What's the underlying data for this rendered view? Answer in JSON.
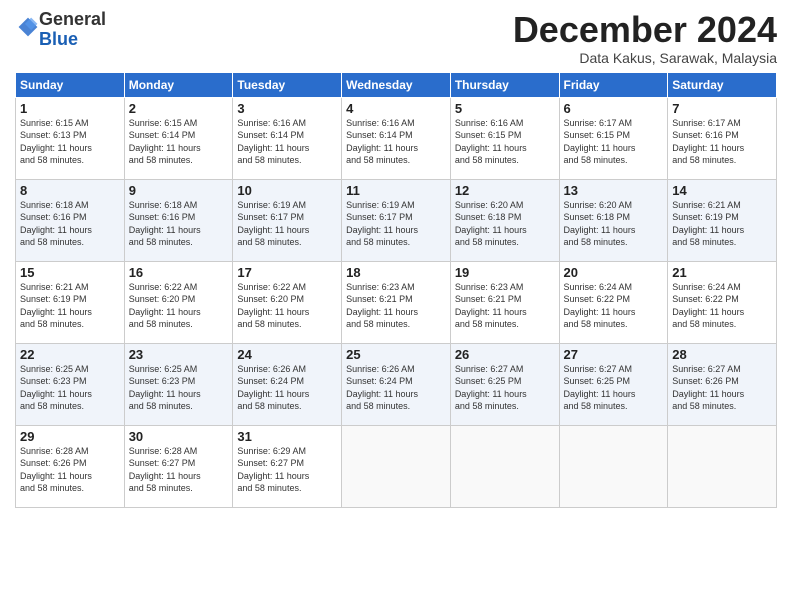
{
  "header": {
    "logo_general": "General",
    "logo_blue": "Blue",
    "month_title": "December 2024",
    "subtitle": "Data Kakus, Sarawak, Malaysia"
  },
  "days_of_week": [
    "Sunday",
    "Monday",
    "Tuesday",
    "Wednesday",
    "Thursday",
    "Friday",
    "Saturday"
  ],
  "weeks": [
    [
      {
        "day": 1,
        "sunrise": "6:15 AM",
        "sunset": "6:13 PM",
        "daylight": "11 hours and 58 minutes."
      },
      {
        "day": 2,
        "sunrise": "6:15 AM",
        "sunset": "6:14 PM",
        "daylight": "11 hours and 58 minutes."
      },
      {
        "day": 3,
        "sunrise": "6:16 AM",
        "sunset": "6:14 PM",
        "daylight": "11 hours and 58 minutes."
      },
      {
        "day": 4,
        "sunrise": "6:16 AM",
        "sunset": "6:14 PM",
        "daylight": "11 hours and 58 minutes."
      },
      {
        "day": 5,
        "sunrise": "6:16 AM",
        "sunset": "6:15 PM",
        "daylight": "11 hours and 58 minutes."
      },
      {
        "day": 6,
        "sunrise": "6:17 AM",
        "sunset": "6:15 PM",
        "daylight": "11 hours and 58 minutes."
      },
      {
        "day": 7,
        "sunrise": "6:17 AM",
        "sunset": "6:16 PM",
        "daylight": "11 hours and 58 minutes."
      }
    ],
    [
      {
        "day": 8,
        "sunrise": "6:18 AM",
        "sunset": "6:16 PM",
        "daylight": "11 hours and 58 minutes."
      },
      {
        "day": 9,
        "sunrise": "6:18 AM",
        "sunset": "6:16 PM",
        "daylight": "11 hours and 58 minutes."
      },
      {
        "day": 10,
        "sunrise": "6:19 AM",
        "sunset": "6:17 PM",
        "daylight": "11 hours and 58 minutes."
      },
      {
        "day": 11,
        "sunrise": "6:19 AM",
        "sunset": "6:17 PM",
        "daylight": "11 hours and 58 minutes."
      },
      {
        "day": 12,
        "sunrise": "6:20 AM",
        "sunset": "6:18 PM",
        "daylight": "11 hours and 58 minutes."
      },
      {
        "day": 13,
        "sunrise": "6:20 AM",
        "sunset": "6:18 PM",
        "daylight": "11 hours and 58 minutes."
      },
      {
        "day": 14,
        "sunrise": "6:21 AM",
        "sunset": "6:19 PM",
        "daylight": "11 hours and 58 minutes."
      }
    ],
    [
      {
        "day": 15,
        "sunrise": "6:21 AM",
        "sunset": "6:19 PM",
        "daylight": "11 hours and 58 minutes."
      },
      {
        "day": 16,
        "sunrise": "6:22 AM",
        "sunset": "6:20 PM",
        "daylight": "11 hours and 58 minutes."
      },
      {
        "day": 17,
        "sunrise": "6:22 AM",
        "sunset": "6:20 PM",
        "daylight": "11 hours and 58 minutes."
      },
      {
        "day": 18,
        "sunrise": "6:23 AM",
        "sunset": "6:21 PM",
        "daylight": "11 hours and 58 minutes."
      },
      {
        "day": 19,
        "sunrise": "6:23 AM",
        "sunset": "6:21 PM",
        "daylight": "11 hours and 58 minutes."
      },
      {
        "day": 20,
        "sunrise": "6:24 AM",
        "sunset": "6:22 PM",
        "daylight": "11 hours and 58 minutes."
      },
      {
        "day": 21,
        "sunrise": "6:24 AM",
        "sunset": "6:22 PM",
        "daylight": "11 hours and 58 minutes."
      }
    ],
    [
      {
        "day": 22,
        "sunrise": "6:25 AM",
        "sunset": "6:23 PM",
        "daylight": "11 hours and 58 minutes."
      },
      {
        "day": 23,
        "sunrise": "6:25 AM",
        "sunset": "6:23 PM",
        "daylight": "11 hours and 58 minutes."
      },
      {
        "day": 24,
        "sunrise": "6:26 AM",
        "sunset": "6:24 PM",
        "daylight": "11 hours and 58 minutes."
      },
      {
        "day": 25,
        "sunrise": "6:26 AM",
        "sunset": "6:24 PM",
        "daylight": "11 hours and 58 minutes."
      },
      {
        "day": 26,
        "sunrise": "6:27 AM",
        "sunset": "6:25 PM",
        "daylight": "11 hours and 58 minutes."
      },
      {
        "day": 27,
        "sunrise": "6:27 AM",
        "sunset": "6:25 PM",
        "daylight": "11 hours and 58 minutes."
      },
      {
        "day": 28,
        "sunrise": "6:27 AM",
        "sunset": "6:26 PM",
        "daylight": "11 hours and 58 minutes."
      }
    ],
    [
      {
        "day": 29,
        "sunrise": "6:28 AM",
        "sunset": "6:26 PM",
        "daylight": "11 hours and 58 minutes."
      },
      {
        "day": 30,
        "sunrise": "6:28 AM",
        "sunset": "6:27 PM",
        "daylight": "11 hours and 58 minutes."
      },
      {
        "day": 31,
        "sunrise": "6:29 AM",
        "sunset": "6:27 PM",
        "daylight": "11 hours and 58 minutes."
      },
      null,
      null,
      null,
      null
    ]
  ],
  "labels": {
    "sunrise": "Sunrise:",
    "sunset": "Sunset:",
    "daylight": "Daylight:"
  }
}
